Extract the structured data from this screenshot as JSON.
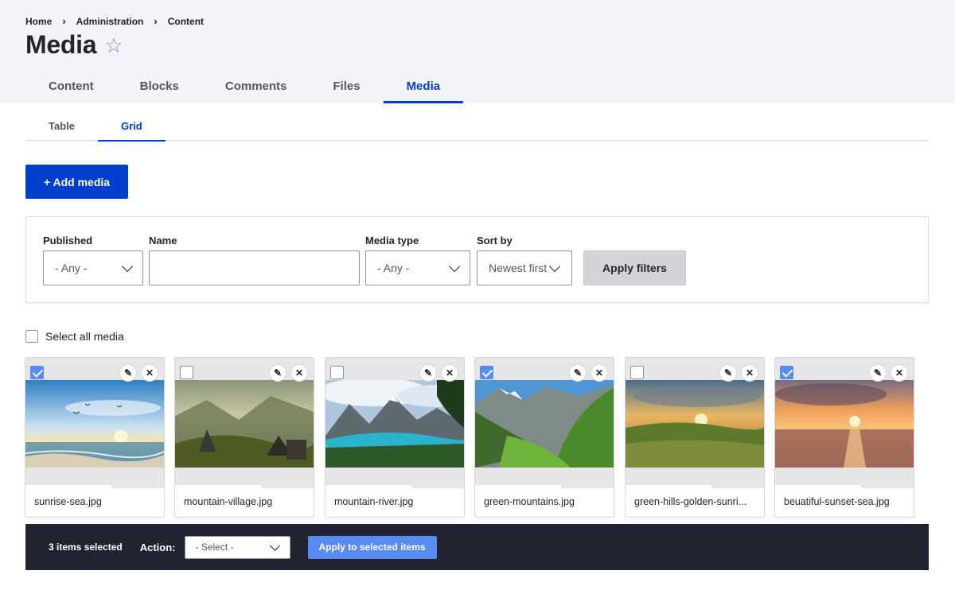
{
  "breadcrumb": {
    "items": [
      "Home",
      "Administration",
      "Content"
    ],
    "separator": "›"
  },
  "page": {
    "title": "Media",
    "favorite_icon": "star-outline-icon"
  },
  "primary_tabs": [
    {
      "label": "Content",
      "active": false
    },
    {
      "label": "Blocks",
      "active": false
    },
    {
      "label": "Comments",
      "active": false
    },
    {
      "label": "Files",
      "active": false
    },
    {
      "label": "Media",
      "active": true
    }
  ],
  "secondary_tabs": [
    {
      "label": "Table",
      "active": false
    },
    {
      "label": "Grid",
      "active": true
    }
  ],
  "add_media_label": "+ Add media",
  "filters": {
    "published": {
      "label": "Published",
      "value": "- Any -"
    },
    "name": {
      "label": "Name",
      "value": ""
    },
    "media_type": {
      "label": "Media type",
      "value": "- Any -"
    },
    "sort_by": {
      "label": "Sort by",
      "value": "Newest first"
    },
    "apply_label": "Apply filters"
  },
  "select_all_label": "Select all media",
  "media_items": [
    {
      "filename": "sunrise-sea.jpg",
      "checked": true
    },
    {
      "filename": "mountain-village.jpg",
      "checked": false
    },
    {
      "filename": "mountain-river.jpg",
      "checked": false
    },
    {
      "filename": "green-mountains.jpg",
      "checked": true
    },
    {
      "filename": "green-hills-golden-sunri...",
      "checked": false
    },
    {
      "filename": "beuatiful-sunset-sea.jpg",
      "checked": true
    }
  ],
  "card_icons": {
    "edit": "pencil-icon",
    "remove": "close-icon"
  },
  "bulk_bar": {
    "count_label": "3 items selected",
    "action_label": "Action:",
    "action_value": "- Select -",
    "apply_label": "Apply to selected items"
  },
  "colors": {
    "accent": "#003ecc",
    "checkbox_checked": "#598bf4",
    "bulk_bar_bg": "#222330",
    "header_bg": "#f3f4f9"
  }
}
